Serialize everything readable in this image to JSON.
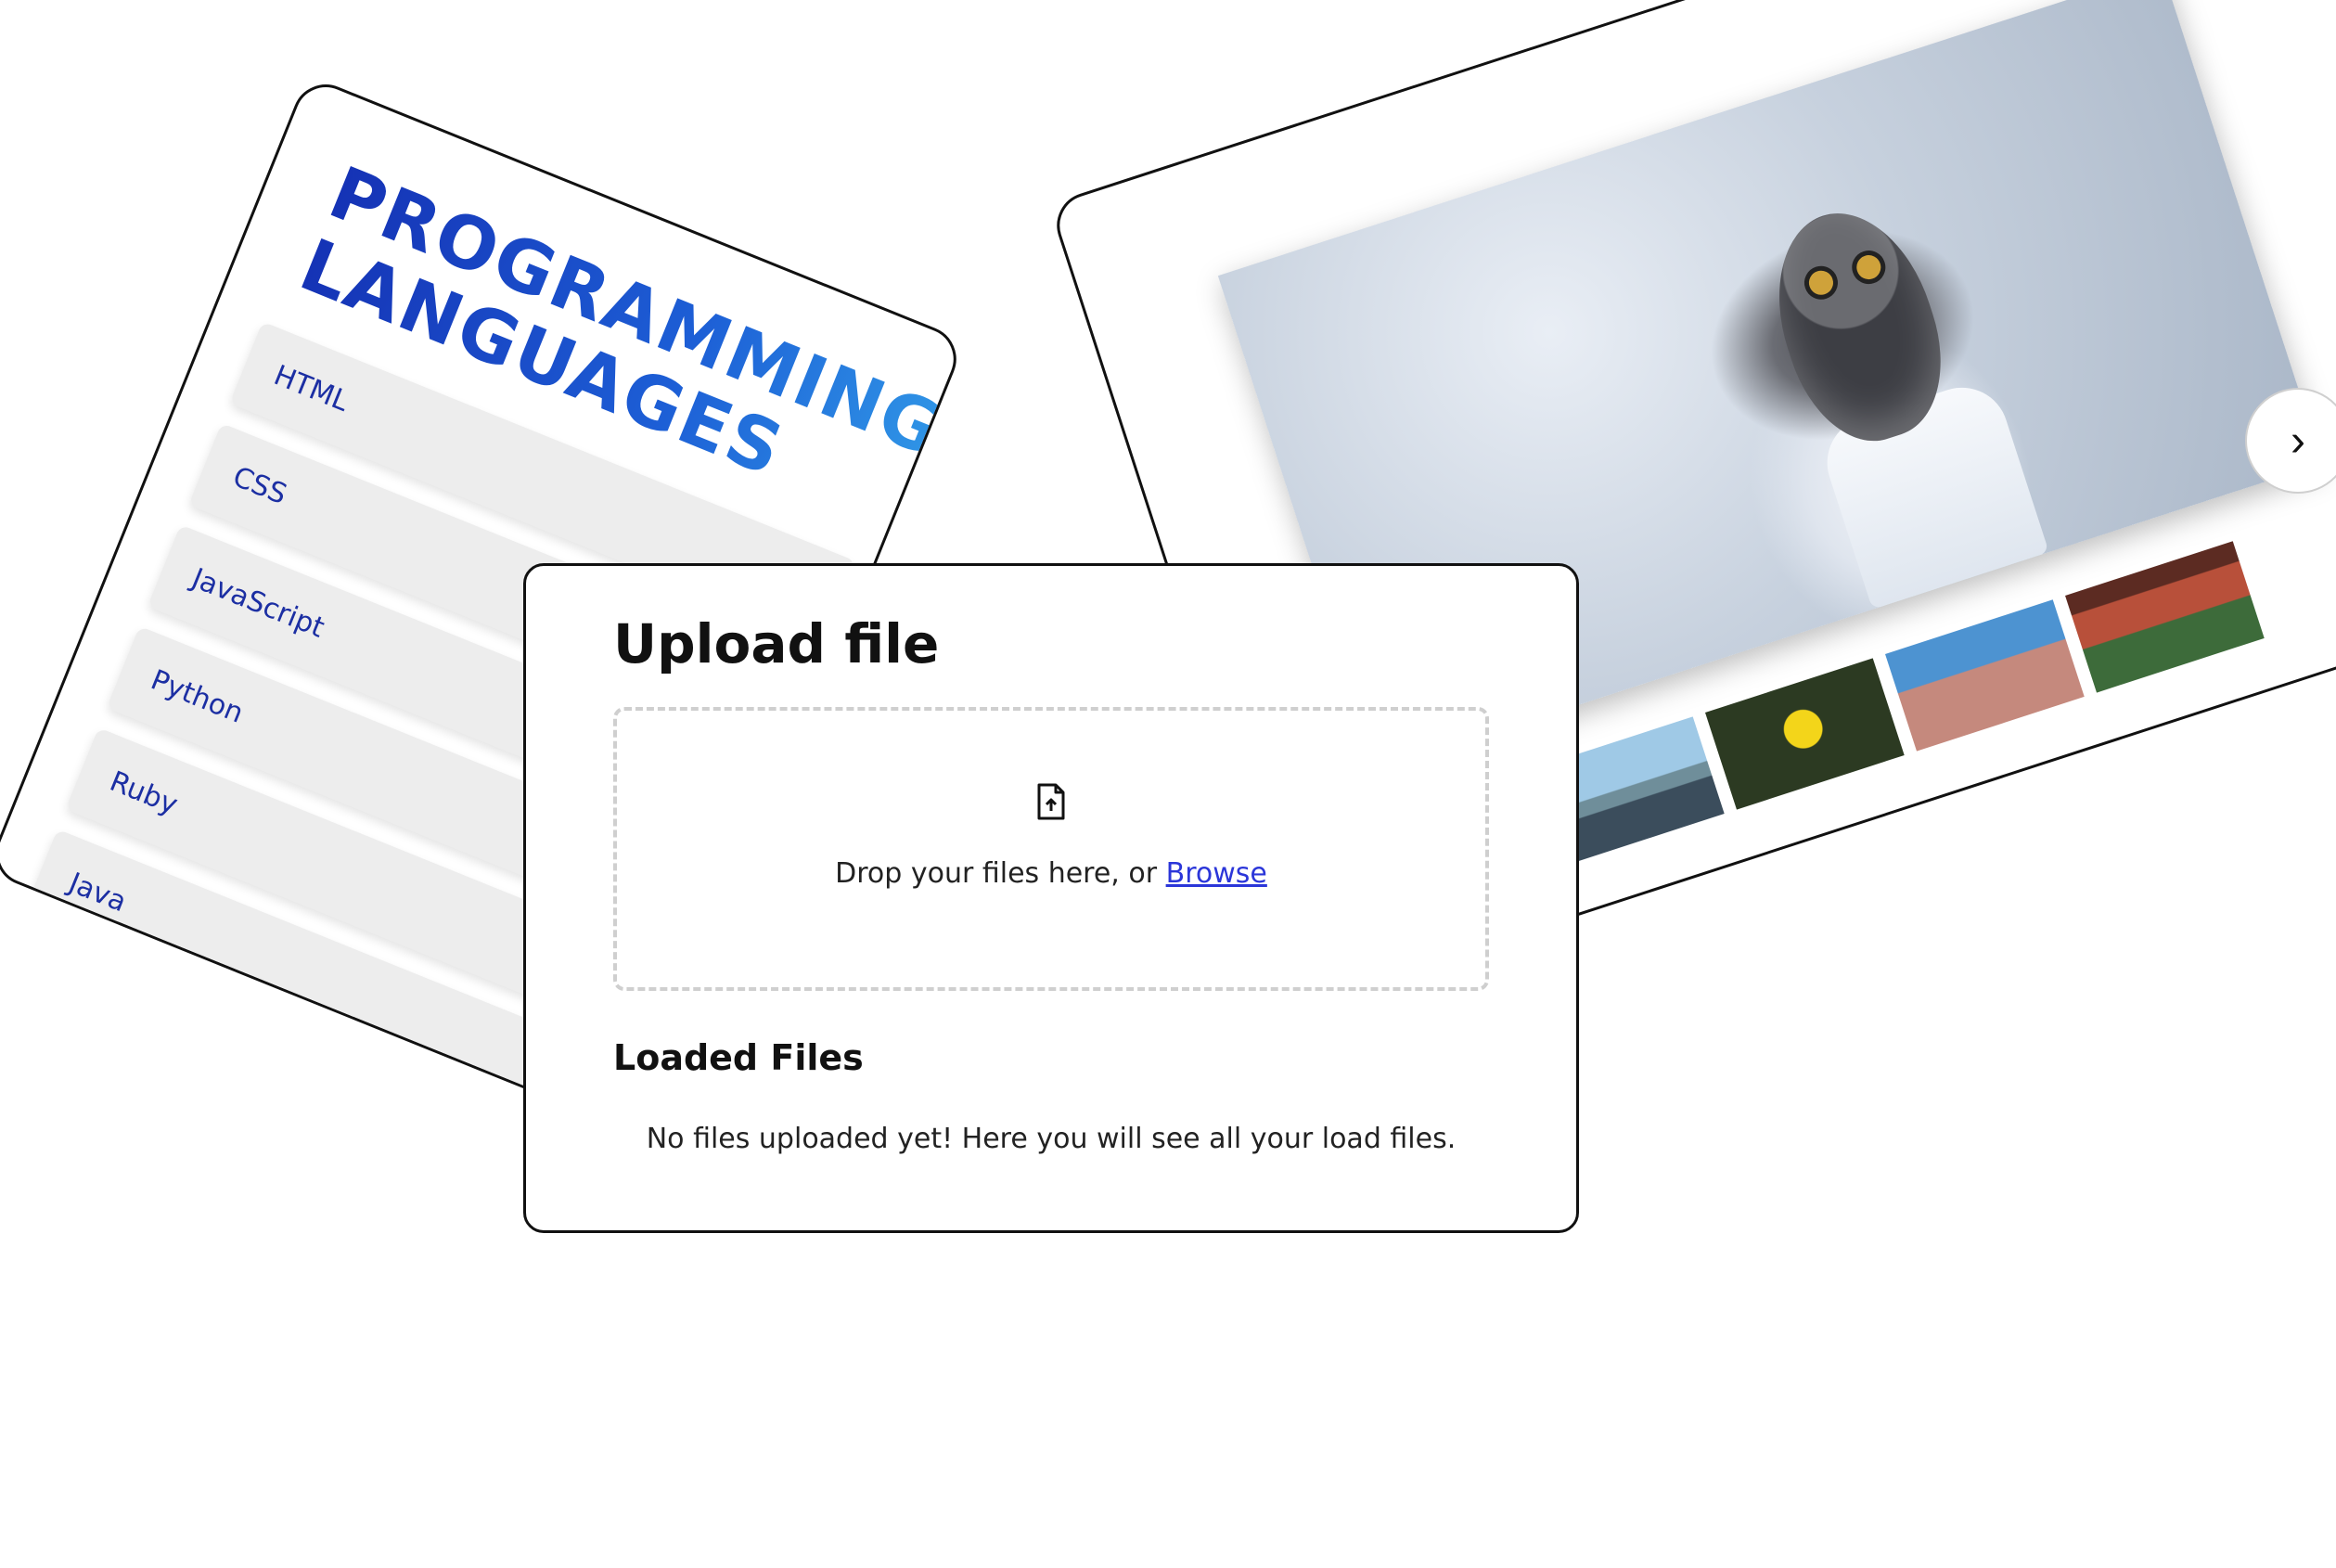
{
  "languages_panel": {
    "title": "PROGRAMMING\nLANGUAGES",
    "items": [
      "HTML",
      "CSS",
      "JavaScript",
      "Python",
      "Ruby",
      "Java",
      ""
    ],
    "caret_icon": "chevron-up-icon"
  },
  "gallery": {
    "next_icon": "chevron-right-icon",
    "main_image": "snowy-owl-photo",
    "thumbnails": [
      "city-car-photo",
      "yellow-bird-photo",
      "beach-lighthouse-photo",
      "red-rocks-photo"
    ]
  },
  "upload": {
    "title": "Upload file",
    "drop_text": "Drop your files here, or ",
    "browse_label": "Browse",
    "loaded_title": "Loaded Files",
    "empty_message": "No files uploaded yet! Here you will see all your load files."
  },
  "colors": {
    "accent_blue": "#1c2fa3",
    "link_blue": "#2b36d9",
    "list_bg": "#ededed"
  }
}
